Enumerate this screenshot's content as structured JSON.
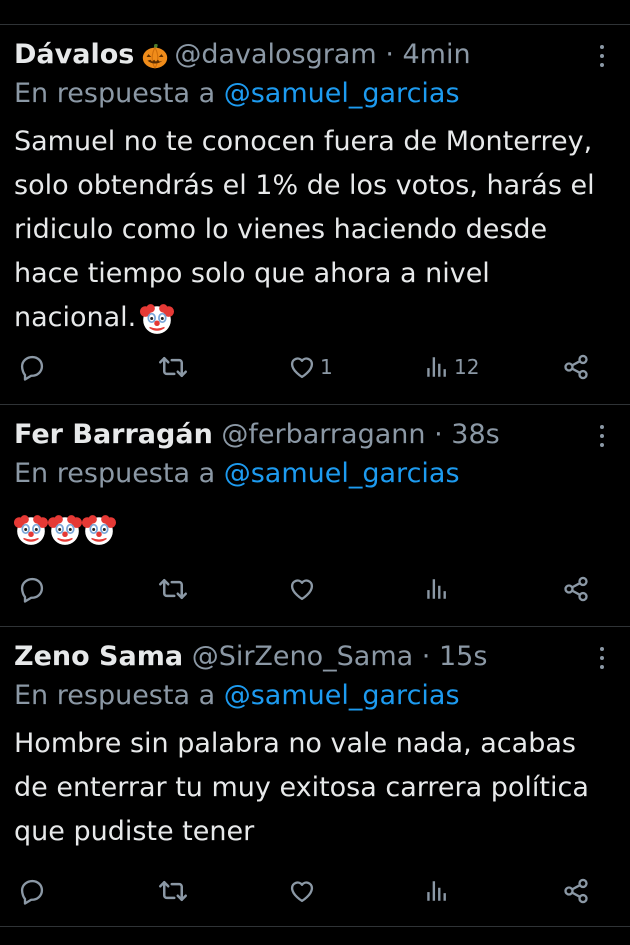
{
  "tweets": [
    {
      "name": "Dávalos",
      "handle": "@davalosgram",
      "separator": "·",
      "time": "4min",
      "reply_prefix": "En respuesta a",
      "reply_to": "@samuel_garcias",
      "text": "Samuel no te conocen fuera de Monterrey, solo obtendrás el 1% de los votos, harás el ridiculo como lo vienes haciendo desde hace tiempo solo que ahora a nivel nacional.",
      "name_emoji": "pumpkin-icon",
      "trailing_emojis": [
        "clown-face-icon"
      ],
      "likes": "1",
      "views": "12"
    },
    {
      "name": "Fer Barragán",
      "handle": "@ferbarragann",
      "separator": "·",
      "time": "38s",
      "reply_prefix": "En respuesta a",
      "reply_to": "@samuel_garcias",
      "text": "",
      "trailing_emojis": [
        "clown-face-icon",
        "clown-face-icon",
        "clown-face-icon"
      ],
      "likes": "",
      "views": ""
    },
    {
      "name": "Zeno Sama",
      "handle": "@SirZeno_Sama",
      "separator": "·",
      "time": "15s",
      "reply_prefix": "En respuesta a",
      "reply_to": "@samuel_garcias",
      "text": "Hombre sin palabra no vale nada, acabas de enterrar tu muy exitosa carrera política que pudiste tener",
      "trailing_emojis": [],
      "likes": "",
      "views": ""
    }
  ],
  "colors": {
    "background": "#000000",
    "text": "#e7e9ea",
    "secondary": "#8b98a5",
    "link": "#1d9bf0",
    "border": "#2f3336"
  }
}
